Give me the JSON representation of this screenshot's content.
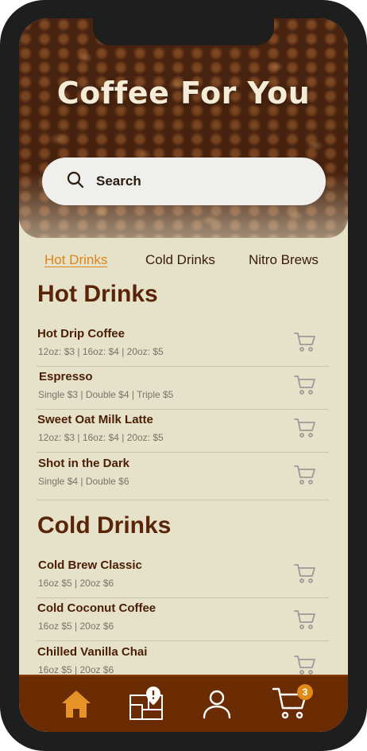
{
  "header": {
    "title": "Coffee For You",
    "search_placeholder": "Search"
  },
  "tabs": [
    {
      "label": "Hot Drinks",
      "active": true
    },
    {
      "label": "Cold Drinks",
      "active": false
    },
    {
      "label": "Nitro Brews",
      "active": false
    }
  ],
  "hot_section": {
    "title": "Hot Drinks",
    "items": [
      {
        "name": "Hot Drip Coffee",
        "prices": "12oz: $3  |  16oz: $4  |  20oz: $5"
      },
      {
        "name": "Espresso",
        "prices": "Single $3  |  Double $4  |  Triple $5"
      },
      {
        "name": "Sweet Oat Milk Latte",
        "prices": "12oz: $3  |  16oz: $4  |  20oz: $5"
      },
      {
        "name": "Shot in the Dark",
        "prices": "Single $4  |  Double $6"
      }
    ]
  },
  "cold_section": {
    "title": "Cold Drinks",
    "items": [
      {
        "name": "Cold Brew Classic",
        "prices": "16oz $5  |  20oz $6"
      },
      {
        "name": "Cold Coconut Coffee",
        "prices": "16oz $5  |  20oz $6"
      },
      {
        "name": "Chilled Vanilla Chai",
        "prices": "16oz $5  |  20oz $6"
      }
    ]
  },
  "bottom_nav": {
    "items": [
      {
        "icon": "home-icon",
        "active": true
      },
      {
        "icon": "map-alert-icon",
        "active": false
      },
      {
        "icon": "profile-icon",
        "active": false
      },
      {
        "icon": "cart-icon",
        "active": false
      }
    ],
    "cart_count": "3"
  },
  "colors": {
    "accent": "#d9851c",
    "brand_brown": "#6b2c03",
    "background": "#e6e2ca",
    "heading": "#5a2408"
  }
}
